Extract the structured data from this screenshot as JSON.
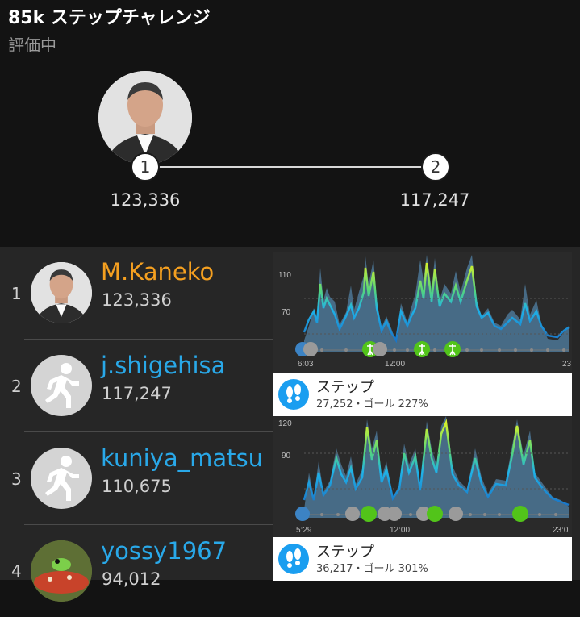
{
  "header": {
    "title": "85k ステップチャレンジ",
    "status": "評価中"
  },
  "podium": [
    {
      "rank": "1",
      "steps": "123,336"
    },
    {
      "rank": "2",
      "steps": "117,247"
    }
  ],
  "leaderboard": [
    {
      "rank": "1",
      "name": "M.Kaneko",
      "steps": "123,336",
      "is_me": true
    },
    {
      "rank": "2",
      "name": "j.shigehisa",
      "steps": "117,247"
    },
    {
      "rank": "3",
      "name": "kuniya_matsu",
      "steps": "110,675"
    },
    {
      "rank": "4",
      "name": "yossy1967",
      "steps": "94,012"
    }
  ],
  "cards": [
    {
      "chart": {
        "y_ticks": [
          "110",
          "70"
        ],
        "x_ticks": [
          "6:03",
          "12:00",
          "23"
        ]
      },
      "footer": {
        "title": "ステップ",
        "subtitle": "27,252・ゴール 227%"
      }
    },
    {
      "chart": {
        "y_ticks": [
          "120",
          "90"
        ],
        "x_ticks": [
          "5:29",
          "12:00",
          "23:0"
        ]
      },
      "footer": {
        "title": "ステップ",
        "subtitle": "36,217・ゴール 301%"
      }
    }
  ],
  "colors": {
    "accent_me": "#f5a020",
    "accent_name": "#29a8e8",
    "step_icon": "#1a9ef0",
    "activity_green": "#52c41a"
  }
}
